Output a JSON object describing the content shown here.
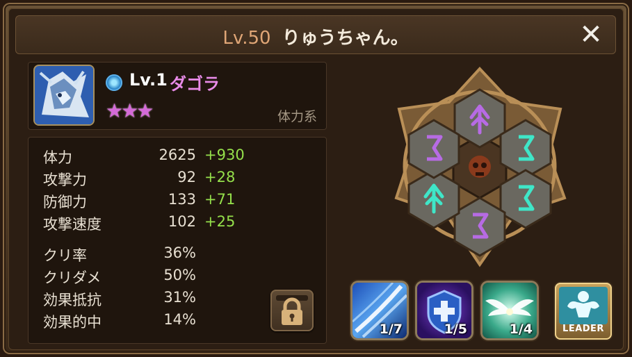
{
  "header": {
    "level_label": "Lv.50",
    "player_name": "りゅうちゃん。",
    "close_icon": "close-x-icon"
  },
  "monster": {
    "element_icon": "water-element-icon",
    "level": "Lv.1",
    "name": "ダゴラ",
    "stars": "★★★",
    "star_count": 3,
    "type": "体力系"
  },
  "stats": [
    {
      "label": "体力",
      "value": "2625",
      "bonus": "+930"
    },
    {
      "label": "攻撃力",
      "value": "92",
      "bonus": "+28"
    },
    {
      "label": "防御力",
      "value": "133",
      "bonus": "+71"
    },
    {
      "label": "攻撃速度",
      "value": "102",
      "bonus": "+25"
    }
  ],
  "substats": [
    {
      "label": "クリ率",
      "value": "36%"
    },
    {
      "label": "クリダメ",
      "value": "50%"
    },
    {
      "label": "効果抵抗",
      "value": "31%"
    },
    {
      "label": "効果的中",
      "value": "14%"
    }
  ],
  "skills": [
    {
      "icon": "water-slash-skill-icon",
      "level": "1/7"
    },
    {
      "icon": "shield-heal-skill-icon",
      "level": "1/5"
    },
    {
      "icon": "wings-skill-icon",
      "level": "1/4"
    }
  ],
  "leader": {
    "label": "LEADER",
    "icon": "muscle-leader-icon"
  },
  "lock_icon": "padlock-icon",
  "colors": {
    "bonus_green": "#95e04b",
    "name_pink": "#e88be8",
    "level_orange": "#e0a676",
    "rune_purple": "#b76be4",
    "rune_teal": "#3fe6c8"
  }
}
